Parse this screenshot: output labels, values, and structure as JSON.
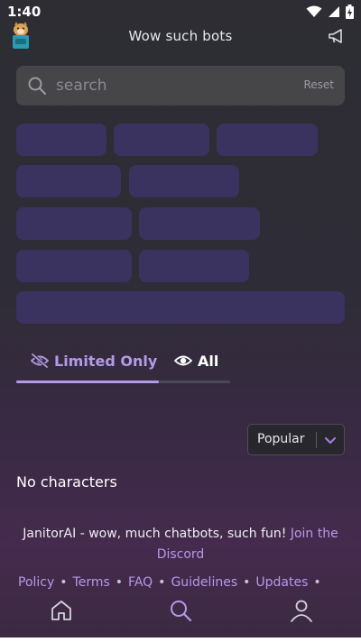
{
  "status_bar": {
    "time": "1:40",
    "icons": [
      "wifi-icon",
      "signal-icon",
      "battery-charging-icon"
    ]
  },
  "header": {
    "title": "Wow such bots",
    "avatar": "doge-avatar",
    "announce_icon": "megaphone-icon"
  },
  "search": {
    "placeholder": "search",
    "value": "",
    "reset_label": "Reset"
  },
  "tags": {
    "count": 10,
    "color": "#3a3360"
  },
  "tabs": [
    {
      "label": "Limited Only",
      "icon": "eye-off-icon",
      "active": true
    },
    {
      "label": "All",
      "icon": "eye-icon",
      "active": false
    }
  ],
  "sort": {
    "selected": "Popular"
  },
  "results": {
    "empty_message": "No characters"
  },
  "footer": {
    "brand": "JanitorAI",
    "tagline": " - wow, much chatbots, such fun! ",
    "join_link": "Join the Discord",
    "links": [
      "Policy",
      "Terms",
      "FAQ",
      "Guidelines",
      "Updates"
    ]
  },
  "bottom_nav": {
    "items": [
      "home-icon",
      "search-icon",
      "profile-icon"
    ],
    "active": "search-icon"
  },
  "colors": {
    "accent": "#b39ae8",
    "tag_bg": "#3a3360",
    "search_bg": "#464649"
  }
}
